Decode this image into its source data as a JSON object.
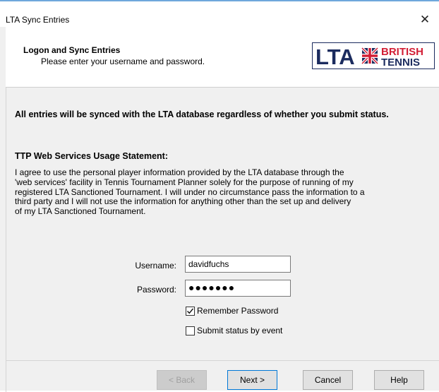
{
  "window": {
    "title": "LTA Sync Entries",
    "close_glyph": "✕"
  },
  "header": {
    "title": "Logon and Sync Entries",
    "subtitle": "Please enter your username and password.",
    "logo": {
      "text_lta": "LTA",
      "text_british": "BRITISH",
      "text_tennis": "TENNIS",
      "navy": "#1b2b5e",
      "red": "#d21e35"
    }
  },
  "content": {
    "intro": "All entries will be synced with the LTA database regardless of whether you submit status.",
    "statement_heading": "TTP Web Services Usage Statement:",
    "statement_lines": [
      "I agree to use the personal player information provided by the LTA database through the",
      "'web services' facility in Tennis Tournament Planner solely for the purpose of running of my",
      "registered LTA Sanctioned Tournament.  I will under no circumstance pass the information to a",
      "third party and I will not use the information for anything other than the set up and delivery",
      "of my LTA Sanctioned Tournament."
    ]
  },
  "form": {
    "username_label": "Username:",
    "username_value": "davidfuchs",
    "password_label": "Password:",
    "password_value": "●●●●●●●",
    "remember_label": "Remember Password",
    "remember_checked": true,
    "submit_status_label": "Submit status by event",
    "submit_status_checked": false
  },
  "buttons": {
    "back": "< Back",
    "next": "Next >",
    "cancel": "Cancel",
    "help": "Help"
  }
}
